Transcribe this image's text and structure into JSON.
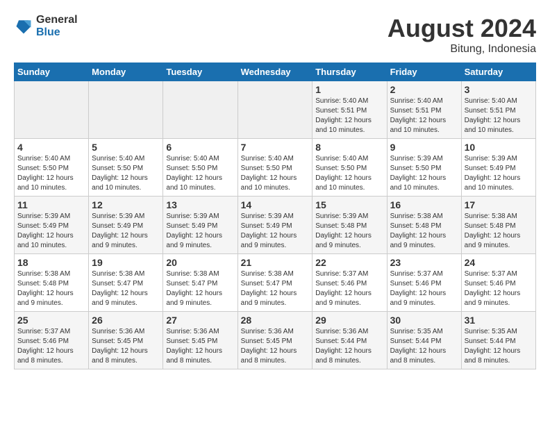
{
  "header": {
    "logo_general": "General",
    "logo_blue": "Blue",
    "main_title": "August 2024",
    "sub_title": "Bitung, Indonesia"
  },
  "days_of_week": [
    "Sunday",
    "Monday",
    "Tuesday",
    "Wednesday",
    "Thursday",
    "Friday",
    "Saturday"
  ],
  "weeks": [
    [
      {
        "num": "",
        "info": ""
      },
      {
        "num": "",
        "info": ""
      },
      {
        "num": "",
        "info": ""
      },
      {
        "num": "",
        "info": ""
      },
      {
        "num": "1",
        "info": "Sunrise: 5:40 AM\nSunset: 5:51 PM\nDaylight: 12 hours\nand 10 minutes."
      },
      {
        "num": "2",
        "info": "Sunrise: 5:40 AM\nSunset: 5:51 PM\nDaylight: 12 hours\nand 10 minutes."
      },
      {
        "num": "3",
        "info": "Sunrise: 5:40 AM\nSunset: 5:51 PM\nDaylight: 12 hours\nand 10 minutes."
      }
    ],
    [
      {
        "num": "4",
        "info": "Sunrise: 5:40 AM\nSunset: 5:50 PM\nDaylight: 12 hours\nand 10 minutes."
      },
      {
        "num": "5",
        "info": "Sunrise: 5:40 AM\nSunset: 5:50 PM\nDaylight: 12 hours\nand 10 minutes."
      },
      {
        "num": "6",
        "info": "Sunrise: 5:40 AM\nSunset: 5:50 PM\nDaylight: 12 hours\nand 10 minutes."
      },
      {
        "num": "7",
        "info": "Sunrise: 5:40 AM\nSunset: 5:50 PM\nDaylight: 12 hours\nand 10 minutes."
      },
      {
        "num": "8",
        "info": "Sunrise: 5:40 AM\nSunset: 5:50 PM\nDaylight: 12 hours\nand 10 minutes."
      },
      {
        "num": "9",
        "info": "Sunrise: 5:39 AM\nSunset: 5:50 PM\nDaylight: 12 hours\nand 10 minutes."
      },
      {
        "num": "10",
        "info": "Sunrise: 5:39 AM\nSunset: 5:49 PM\nDaylight: 12 hours\nand 10 minutes."
      }
    ],
    [
      {
        "num": "11",
        "info": "Sunrise: 5:39 AM\nSunset: 5:49 PM\nDaylight: 12 hours\nand 10 minutes."
      },
      {
        "num": "12",
        "info": "Sunrise: 5:39 AM\nSunset: 5:49 PM\nDaylight: 12 hours\nand 9 minutes."
      },
      {
        "num": "13",
        "info": "Sunrise: 5:39 AM\nSunset: 5:49 PM\nDaylight: 12 hours\nand 9 minutes."
      },
      {
        "num": "14",
        "info": "Sunrise: 5:39 AM\nSunset: 5:49 PM\nDaylight: 12 hours\nand 9 minutes."
      },
      {
        "num": "15",
        "info": "Sunrise: 5:39 AM\nSunset: 5:48 PM\nDaylight: 12 hours\nand 9 minutes."
      },
      {
        "num": "16",
        "info": "Sunrise: 5:38 AM\nSunset: 5:48 PM\nDaylight: 12 hours\nand 9 minutes."
      },
      {
        "num": "17",
        "info": "Sunrise: 5:38 AM\nSunset: 5:48 PM\nDaylight: 12 hours\nand 9 minutes."
      }
    ],
    [
      {
        "num": "18",
        "info": "Sunrise: 5:38 AM\nSunset: 5:48 PM\nDaylight: 12 hours\nand 9 minutes."
      },
      {
        "num": "19",
        "info": "Sunrise: 5:38 AM\nSunset: 5:47 PM\nDaylight: 12 hours\nand 9 minutes."
      },
      {
        "num": "20",
        "info": "Sunrise: 5:38 AM\nSunset: 5:47 PM\nDaylight: 12 hours\nand 9 minutes."
      },
      {
        "num": "21",
        "info": "Sunrise: 5:38 AM\nSunset: 5:47 PM\nDaylight: 12 hours\nand 9 minutes."
      },
      {
        "num": "22",
        "info": "Sunrise: 5:37 AM\nSunset: 5:46 PM\nDaylight: 12 hours\nand 9 minutes."
      },
      {
        "num": "23",
        "info": "Sunrise: 5:37 AM\nSunset: 5:46 PM\nDaylight: 12 hours\nand 9 minutes."
      },
      {
        "num": "24",
        "info": "Sunrise: 5:37 AM\nSunset: 5:46 PM\nDaylight: 12 hours\nand 9 minutes."
      }
    ],
    [
      {
        "num": "25",
        "info": "Sunrise: 5:37 AM\nSunset: 5:46 PM\nDaylight: 12 hours\nand 8 minutes."
      },
      {
        "num": "26",
        "info": "Sunrise: 5:36 AM\nSunset: 5:45 PM\nDaylight: 12 hours\nand 8 minutes."
      },
      {
        "num": "27",
        "info": "Sunrise: 5:36 AM\nSunset: 5:45 PM\nDaylight: 12 hours\nand 8 minutes."
      },
      {
        "num": "28",
        "info": "Sunrise: 5:36 AM\nSunset: 5:45 PM\nDaylight: 12 hours\nand 8 minutes."
      },
      {
        "num": "29",
        "info": "Sunrise: 5:36 AM\nSunset: 5:44 PM\nDaylight: 12 hours\nand 8 minutes."
      },
      {
        "num": "30",
        "info": "Sunrise: 5:35 AM\nSunset: 5:44 PM\nDaylight: 12 hours\nand 8 minutes."
      },
      {
        "num": "31",
        "info": "Sunrise: 5:35 AM\nSunset: 5:44 PM\nDaylight: 12 hours\nand 8 minutes."
      }
    ]
  ]
}
